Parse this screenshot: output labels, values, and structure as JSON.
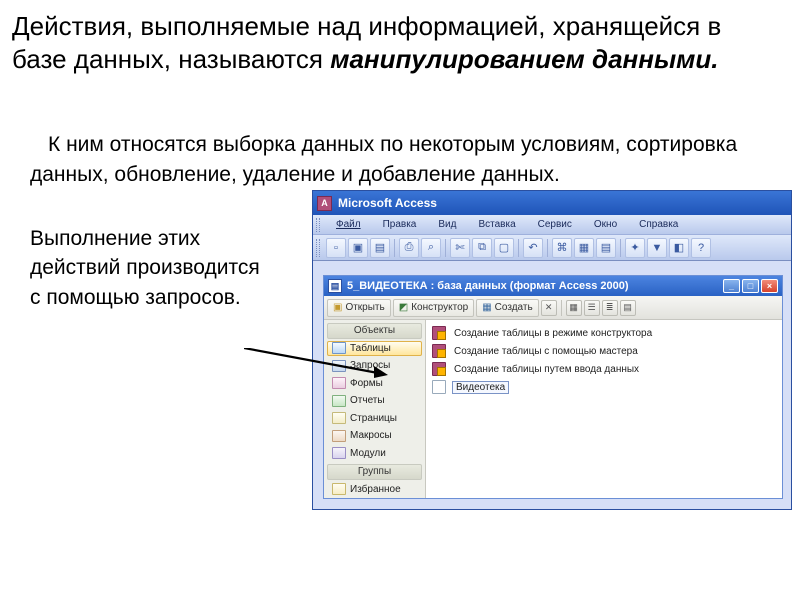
{
  "intro": {
    "line1": "Действия, выполняемые над информацией, хранящейся в базе данных, называются",
    "emph": "манипулированием данными."
  },
  "body": {
    "p1": "К ним относятся выборка данных по некоторым условиям, сортировка данных, обновление, удаление и добавление данных.",
    "p2": "Выполнение этих",
    "p3": "действий производится",
    "p4": "с помощью запросов."
  },
  "app": {
    "title": "Microsoft Access",
    "logo_letter": "A",
    "menus": [
      "Файл",
      "Правка",
      "Вид",
      "Вставка",
      "Сервис",
      "Окно",
      "Справка"
    ]
  },
  "dbwin": {
    "title": "5_ВИДЕОТЕКА : база данных (формат Access 2000)",
    "tb": {
      "open": "Открыть",
      "design": "Конструктор",
      "create": "Создать"
    },
    "obj_header": "Объекты",
    "objects": [
      {
        "key": "tables",
        "label": "Таблицы",
        "sel": true
      },
      {
        "key": "queries",
        "label": "Запросы"
      },
      {
        "key": "forms",
        "label": "Формы"
      },
      {
        "key": "reports",
        "label": "Отчеты"
      },
      {
        "key": "pages",
        "label": "Страницы"
      },
      {
        "key": "macros",
        "label": "Макросы"
      },
      {
        "key": "modules",
        "label": "Модули"
      }
    ],
    "groups_header": "Группы",
    "groups": [
      {
        "key": "fav",
        "label": "Избранное"
      }
    ],
    "list": [
      {
        "icon": "wizard",
        "label": "Создание таблицы в режиме конструктора"
      },
      {
        "icon": "wizard",
        "label": "Создание таблицы с помощью мастера"
      },
      {
        "icon": "wizard",
        "label": "Создание таблицы путем ввода данных"
      },
      {
        "icon": "plain",
        "label": "Видеотека",
        "sel": true
      }
    ]
  }
}
